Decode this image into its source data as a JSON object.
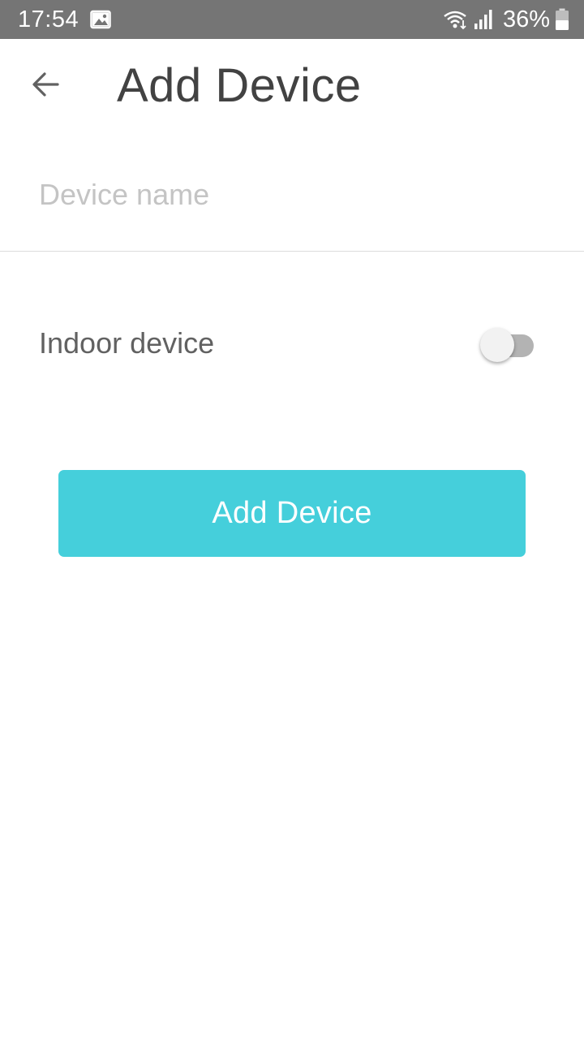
{
  "status_bar": {
    "time": "17:54",
    "battery": "36%",
    "icons": [
      "gallery-icon",
      "wifi-icon",
      "signal-icon",
      "battery-icon"
    ]
  },
  "header": {
    "title": "Add Device",
    "back_icon": "arrow-left-icon"
  },
  "form": {
    "device_name": {
      "value": "",
      "placeholder": "Device name"
    },
    "indoor": {
      "label": "Indoor device",
      "enabled": false
    },
    "submit_label": "Add Device"
  },
  "colors": {
    "status_bar": "#757575",
    "accent": "#45cfdb",
    "title_text": "#424242",
    "placeholder_text": "#c4c4c4",
    "toggle_off_track": "#b3b3b3"
  }
}
